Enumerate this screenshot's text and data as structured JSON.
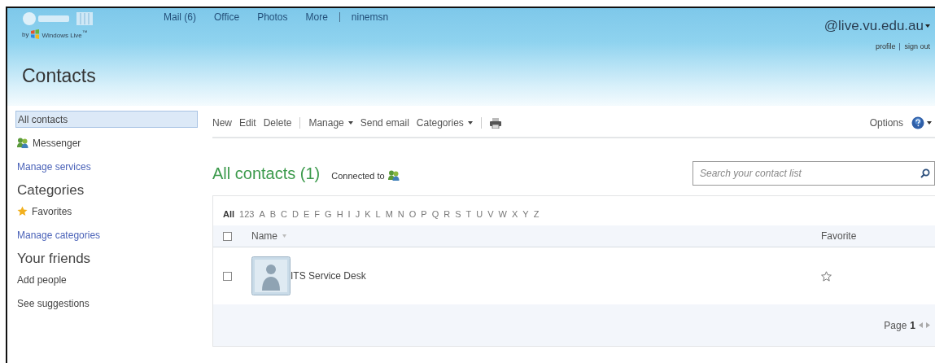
{
  "header": {
    "brand": {
      "by": "by",
      "name": "Windows Live$^{™}$"
    },
    "nav": [
      [
        {
          "label": "Mail (6)"
        },
        {
          "label": "Office"
        },
        {
          "label": "Photos"
        },
        {
          "label": "More"
        }
      ],
      [
        {
          "label": "ninemsn"
        }
      ]
    ],
    "account": {
      "email": "@live.vu.edu.au",
      "links": [
        "profile",
        "sign out"
      ]
    },
    "title": "Contacts"
  },
  "sidebar": [
    {
      "kind": "item",
      "label": "All contacts",
      "selected": true
    },
    {
      "kind": "people",
      "label": "Messenger",
      "selected": false
    },
    {
      "kind": "link",
      "label": "Manage services"
    },
    {
      "kind": "heading",
      "label": "Categories"
    },
    {
      "kind": "star",
      "label": "Favorites",
      "selected": false
    },
    {
      "kind": "link",
      "label": "Manage categories"
    },
    {
      "kind": "heading",
      "label": "Your friends"
    },
    {
      "kind": "item",
      "label": "Add people",
      "selected": false
    },
    {
      "kind": "item",
      "label": "See suggestions",
      "selected": false
    }
  ],
  "toolbar": {
    "groups": [
      [
        {
          "kind": "text",
          "label": "New"
        },
        {
          "kind": "text",
          "label": "Edit"
        },
        {
          "kind": "text",
          "label": "Delete"
        }
      ],
      [
        {
          "kind": "text",
          "label": "Manage",
          "dropdown": true
        },
        {
          "kind": "text",
          "label": "Send email"
        },
        {
          "kind": "text",
          "label": "Categories",
          "dropdown": true
        }
      ],
      [
        {
          "kind": "print"
        }
      ]
    ],
    "options": "Options"
  },
  "heading": {
    "title": "All contacts",
    "count": "(1)",
    "connected": "Connected to"
  },
  "search": {
    "placeholder": "Search your contact list"
  },
  "letters": [
    {
      "label": "All",
      "selected": true
    },
    {
      "label": "123",
      "selected": false
    },
    {
      "label": "A",
      "selected": false
    },
    {
      "label": "B",
      "selected": false
    },
    {
      "label": "C",
      "selected": false
    },
    {
      "label": "D",
      "selected": false
    },
    {
      "label": "E",
      "selected": false
    },
    {
      "label": "F",
      "selected": false
    },
    {
      "label": "G",
      "selected": false
    },
    {
      "label": "H",
      "selected": false
    },
    {
      "label": "I",
      "selected": false
    },
    {
      "label": "J",
      "selected": false
    },
    {
      "label": "K",
      "selected": false
    },
    {
      "label": "L",
      "selected": false
    },
    {
      "label": "M",
      "selected": false
    },
    {
      "label": "N",
      "selected": false
    },
    {
      "label": "O",
      "selected": false
    },
    {
      "label": "P",
      "selected": false
    },
    {
      "label": "Q",
      "selected": false
    },
    {
      "label": "R",
      "selected": false
    },
    {
      "label": "S",
      "selected": false
    },
    {
      "label": "T",
      "selected": false
    },
    {
      "label": "U",
      "selected": false
    },
    {
      "label": "V",
      "selected": false
    },
    {
      "label": "W",
      "selected": false
    },
    {
      "label": "X",
      "selected": false
    },
    {
      "label": "Y",
      "selected": false
    },
    {
      "label": "Z",
      "selected": false
    }
  ],
  "table": {
    "columns": [
      "Name",
      "Favorite"
    ],
    "all_checked": false,
    "rows": [
      {
        "name": "ITS Service Desk",
        "checked": false,
        "favorite": false
      }
    ],
    "pager": {
      "label": "Page",
      "page": "1"
    }
  }
}
